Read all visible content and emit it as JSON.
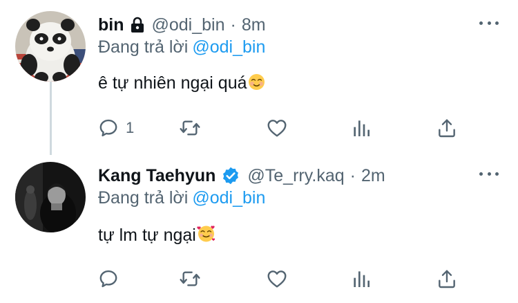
{
  "tweets": [
    {
      "display_name": "bin",
      "badge": "lock-icon",
      "handle": "@odi_bin",
      "separator": "·",
      "time": "8m",
      "reply_prefix": "Đang trả lời",
      "reply_to": "@odi_bin",
      "text": "ê tự nhiên ngại quá",
      "emoji": "☺️",
      "reply_count": "1",
      "avatar": "panda-avatar"
    },
    {
      "display_name": "Kang Taehyun",
      "badge": "verified-icon",
      "handle": "@Te_rry.kaq",
      "separator": "·",
      "time": "2m",
      "reply_prefix": "Đang trả lời",
      "reply_to": "@odi_bin",
      "text": "tự lm tự ngại",
      "emoji": "🥰",
      "reply_count": "",
      "avatar": "dark-photo-avatar"
    }
  ],
  "colors": {
    "text": "#0f1419",
    "secondary": "#536471",
    "link": "#1d9bf0",
    "thread_line": "#cfd9de",
    "verified": "#1d9bf0"
  },
  "icons": [
    "reply-icon",
    "retweet-icon",
    "like-icon",
    "stats-icon",
    "share-icon",
    "more-icon"
  ]
}
